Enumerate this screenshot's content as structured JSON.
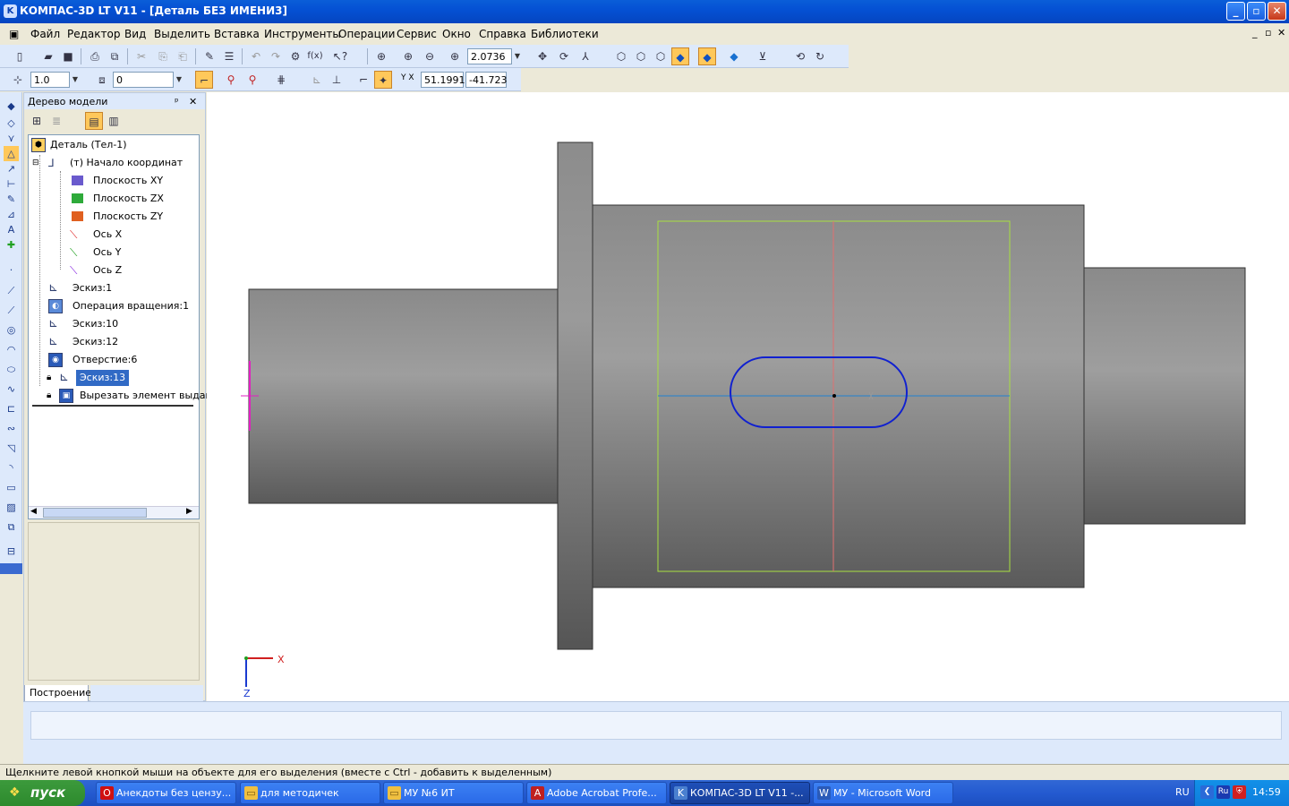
{
  "window": {
    "title": "КОМПАС-3D LT V11 - [Деталь БЕЗ ИМЕНИ3]",
    "app_icon": "kompas-icon",
    "min_label": "_",
    "max_label": "▫",
    "close_label": "✕",
    "mdi_min": "_",
    "mdi_restore": "▫",
    "mdi_close": "✕"
  },
  "menu": [
    "Файл",
    "Редактор",
    "Вид",
    "Выделить",
    "Вставка",
    "Инструменты",
    "Операции",
    "Сервис",
    "Окно",
    "Справка",
    "Библиотеки"
  ],
  "toolbar1": {
    "zoom_value": "2.0736"
  },
  "toolbar2": {
    "step_value": "1.0",
    "layer_value": "0",
    "coord_x": "51.1991",
    "coord_y": "-41.723",
    "coord_label": "Y X"
  },
  "tree": {
    "panel_title": "Дерево модели",
    "pin_label": "ᵖ",
    "close_label": "✕",
    "nodes": [
      {
        "label": "Деталь (Тел-1)",
        "icon": "part-icon"
      },
      {
        "label": "(т) Начало координат",
        "icon": "origin-icon"
      },
      {
        "label": "Плоскость XY",
        "icon": "plane-xy-icon",
        "color": "#6a5acd"
      },
      {
        "label": "Плоскость ZX",
        "icon": "plane-zx-icon",
        "color": "#2eaa3a"
      },
      {
        "label": "Плоскость ZY",
        "icon": "plane-zy-icon",
        "color": "#e06020"
      },
      {
        "label": "Ось X",
        "icon": "axis-x-icon",
        "color": "#e03030"
      },
      {
        "label": "Ось Y",
        "icon": "axis-y-icon",
        "color": "#20a020"
      },
      {
        "label": "Ось Z",
        "icon": "axis-z-icon",
        "color": "#8a2be2"
      },
      {
        "label": "Эскиз:1",
        "icon": "sketch-icon"
      },
      {
        "label": "Операция вращения:1",
        "icon": "revolve-icon"
      },
      {
        "label": "Эскиз:10",
        "icon": "sketch-icon"
      },
      {
        "label": "Эскиз:12",
        "icon": "sketch-icon"
      },
      {
        "label": "Отверстие:6",
        "icon": "hole-icon"
      },
      {
        "label": "Эскиз:13",
        "icon": "sketch-icon",
        "selected": true
      },
      {
        "label": "Вырезать элемент выдав.",
        "icon": "cut-extrude-icon"
      }
    ],
    "tab_label": "Построение"
  },
  "viewport": {
    "axis_x_label": "X",
    "axis_z_label": "Z"
  },
  "status": {
    "hint": "Щелкните левой кнопкой мыши на объекте для его выделения (вместе с Ctrl - добавить к выделенным)"
  },
  "taskbar": {
    "start_label": "пуск",
    "tasks": [
      {
        "label": "Анекдоты без цензу...",
        "icon": "opera-icon",
        "icolor": "#d01010",
        "glyph": "O"
      },
      {
        "label": "для методичек",
        "icon": "folder-icon",
        "icolor": "#f0c040",
        "glyph": "▭"
      },
      {
        "label": "МУ №6 ИТ",
        "icon": "folder-icon",
        "icolor": "#f0c040",
        "glyph": "▭"
      },
      {
        "label": "Adobe Acrobat Profe...",
        "icon": "acrobat-icon",
        "icolor": "#c02020",
        "glyph": "A"
      },
      {
        "label": "КОМПАС-3D LT V11 -...",
        "icon": "kompas-icon",
        "icolor": "#4a80d0",
        "glyph": "K",
        "active": true
      },
      {
        "label": "МУ - Microsoft Word",
        "icon": "word-icon",
        "icolor": "#2a5ab8",
        "glyph": "W"
      }
    ],
    "lang": "RU",
    "lang_tray": "Ru",
    "clock": "14:59"
  }
}
